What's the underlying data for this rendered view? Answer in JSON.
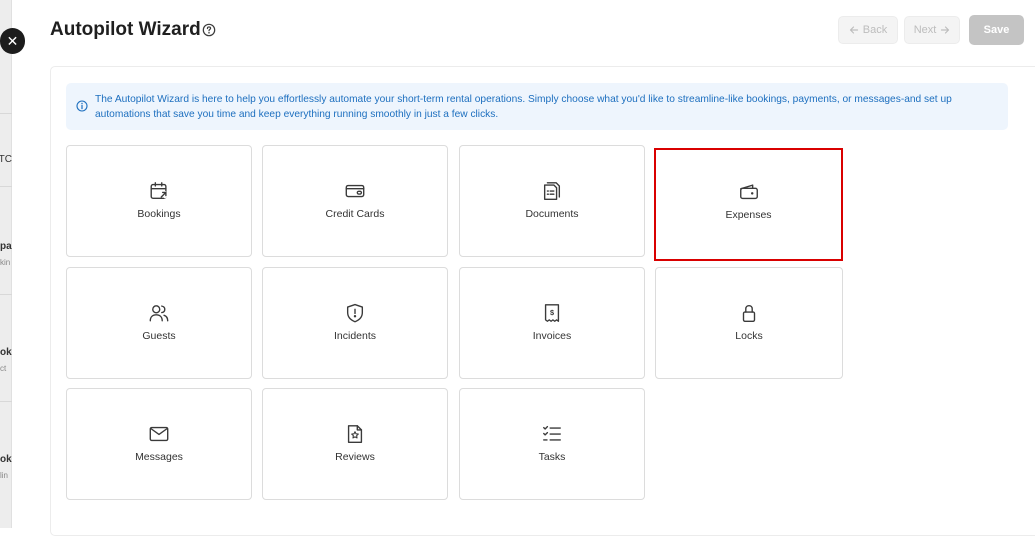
{
  "header": {
    "title": "Autopilot Wizard",
    "back_label": "Back",
    "next_label": "Next",
    "save_label": "Save",
    "close_glyph": "✕"
  },
  "background_fragments": [
    "TC",
    "pa",
    "kin",
    "ok",
    "ct",
    "ok",
    "lin"
  ],
  "info": {
    "text": "The Autopilot Wizard is here to help you effortlessly automate your short-term rental operations. Simply choose what you'd like to streamline-like bookings, payments, or messages-and set up automations that save you time and keep everything running smoothly in just a few clicks."
  },
  "categories": [
    {
      "label": "Bookings",
      "icon": "calendar-icon"
    },
    {
      "label": "Credit Cards",
      "icon": "credit-card-icon"
    },
    {
      "label": "Documents",
      "icon": "documents-icon"
    },
    {
      "label": "Expenses",
      "icon": "wallet-icon",
      "selected": true
    },
    {
      "label": "Guests",
      "icon": "users-icon"
    },
    {
      "label": "Incidents",
      "icon": "shield-alert-icon"
    },
    {
      "label": "Invoices",
      "icon": "receipt-icon"
    },
    {
      "label": "Locks",
      "icon": "lock-icon"
    },
    {
      "label": "Messages",
      "icon": "envelope-icon"
    },
    {
      "label": "Reviews",
      "icon": "star-document-icon"
    },
    {
      "label": "Tasks",
      "icon": "checklist-icon"
    }
  ],
  "colors": {
    "selected_border": "#d90000",
    "info_background": "#eef5fd",
    "info_text": "#1d6fbf",
    "save_button": "#c4c4c4"
  }
}
